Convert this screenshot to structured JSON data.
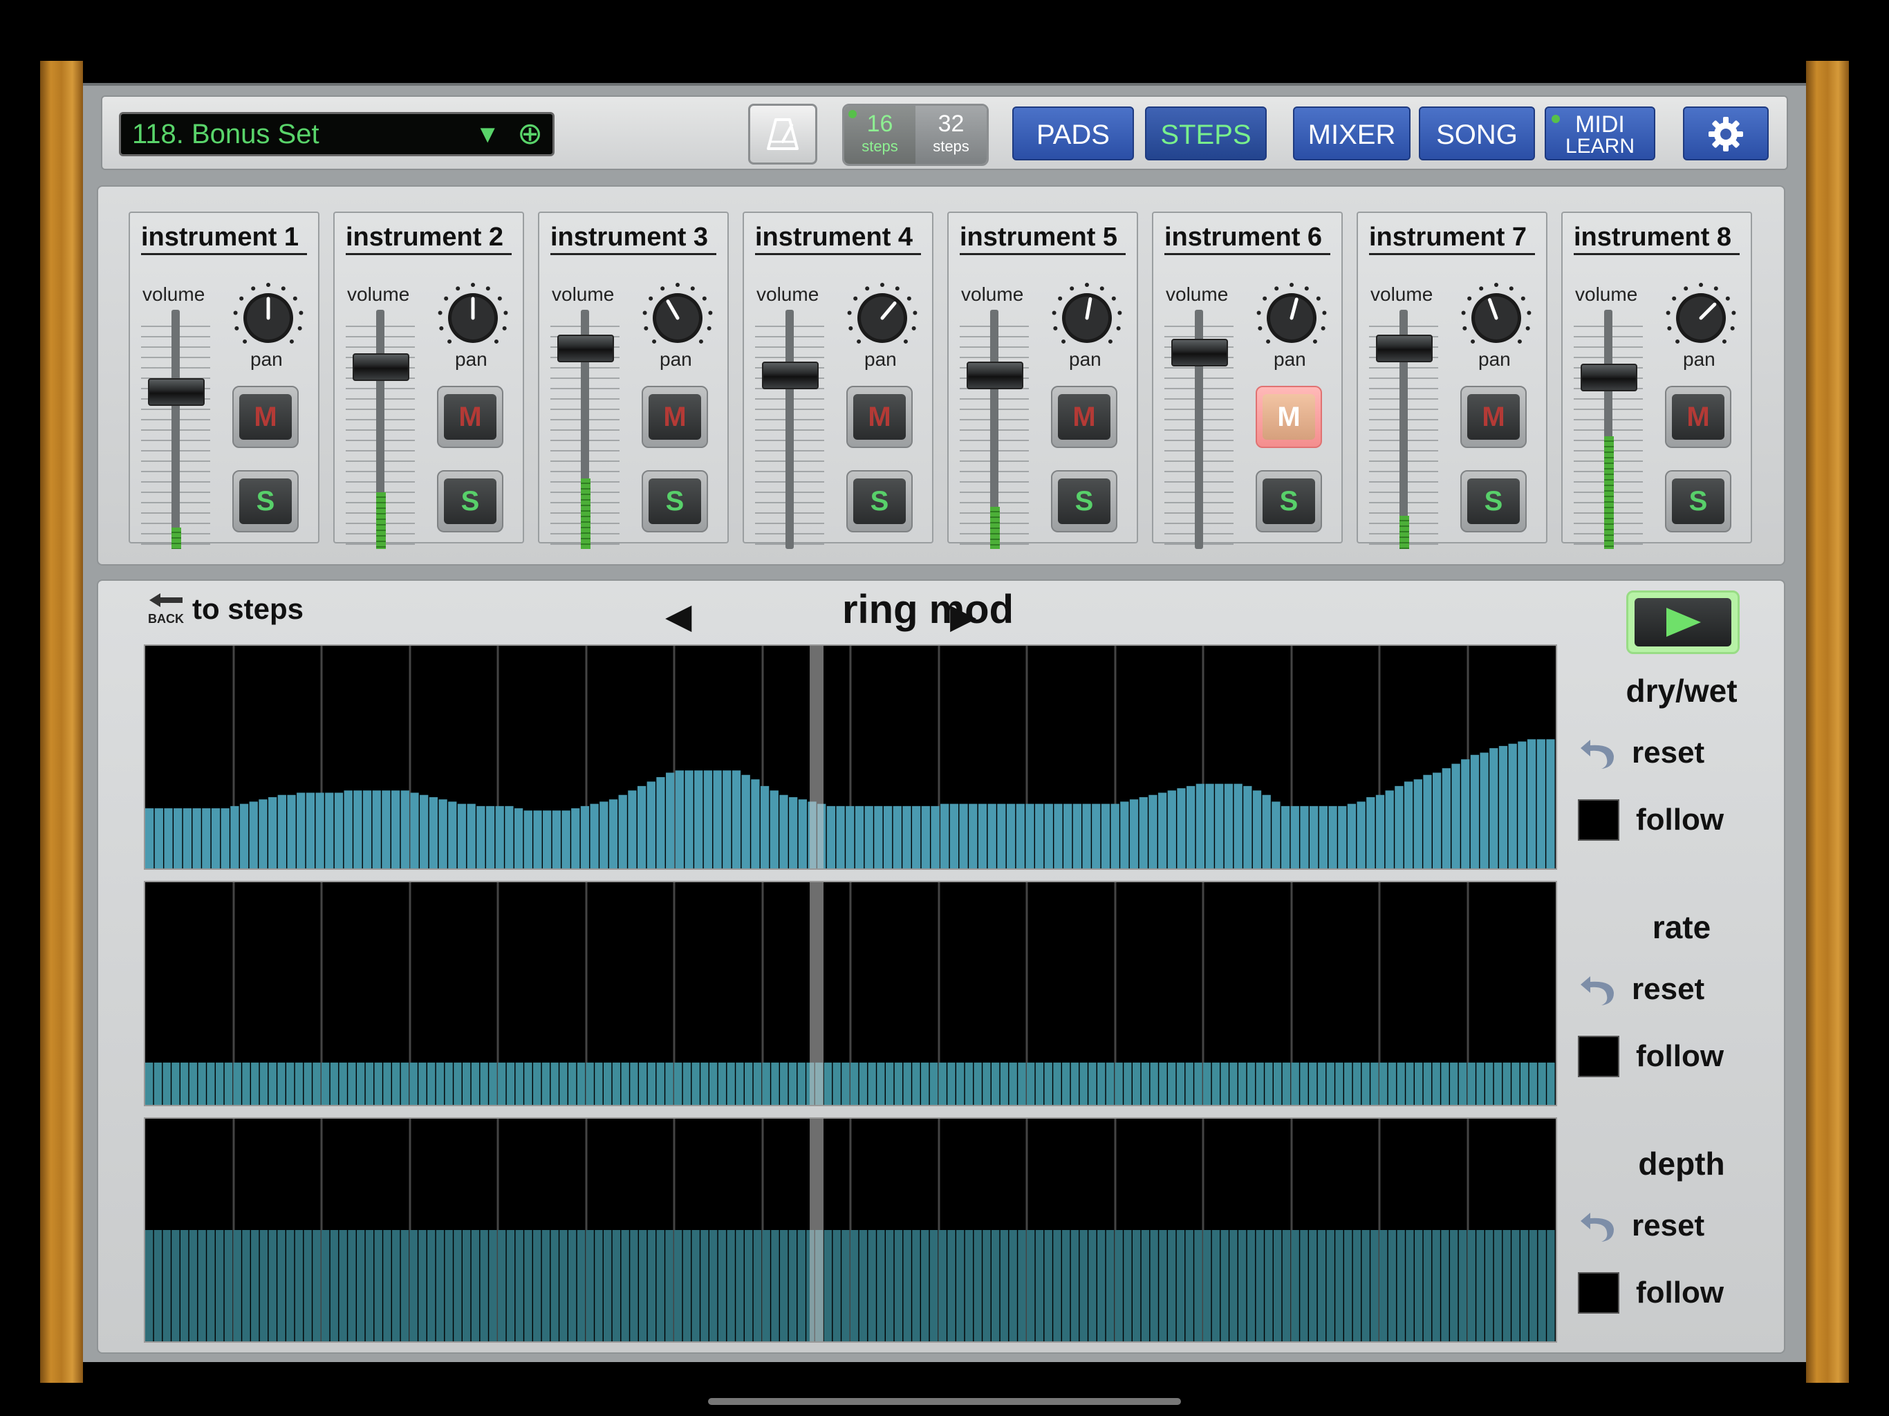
{
  "set": {
    "name": "118. Bonus Set",
    "dropdown_glyph": "▼",
    "add_glyph": "⊕"
  },
  "steps_toggle": [
    {
      "num": "16",
      "label": "steps",
      "active": true
    },
    {
      "num": "32",
      "label": "steps",
      "active": false
    }
  ],
  "nav": {
    "pads": "PADS",
    "steps": "STEPS",
    "mixer": "MIXER",
    "song": "SONG",
    "midi": "MIDI",
    "learn": "LEARN"
  },
  "labels": {
    "volume": "volume",
    "pan": "pan",
    "mute": "M",
    "solo": "S"
  },
  "instruments": [
    {
      "name": "instrument 1",
      "fader": 0.67,
      "meter": 0.09,
      "pan_deg": 0,
      "mute_on": false
    },
    {
      "name": "instrument 2",
      "fader": 0.79,
      "meter": 0.24,
      "pan_deg": 0,
      "mute_on": false
    },
    {
      "name": "instrument 3",
      "fader": 0.88,
      "meter": 0.3,
      "pan_deg": -30,
      "mute_on": false
    },
    {
      "name": "instrument 4",
      "fader": 0.75,
      "meter": 0.0,
      "pan_deg": 40,
      "mute_on": false
    },
    {
      "name": "instrument 5",
      "fader": 0.75,
      "meter": 0.18,
      "pan_deg": 10,
      "mute_on": false
    },
    {
      "name": "instrument 6",
      "fader": 0.86,
      "meter": 0.0,
      "pan_deg": 15,
      "mute_on": true
    },
    {
      "name": "instrument 7",
      "fader": 0.88,
      "meter": 0.14,
      "pan_deg": -20,
      "mute_on": false
    },
    {
      "name": "instrument 8",
      "fader": 0.74,
      "meter": 0.48,
      "pan_deg": 45,
      "mute_on": false
    }
  ],
  "fx": {
    "back_label": "to steps",
    "back_word": "BACK",
    "title": "ring mod",
    "prev": "◀",
    "next": "▶",
    "reset_label": "reset",
    "follow_label": "follow",
    "params": [
      {
        "name": "dry/wet",
        "color": "#4a9ab0",
        "values": [
          0.27,
          0.27,
          0.27,
          0.27,
          0.27,
          0.27,
          0.27,
          0.27,
          0.27,
          0.28,
          0.29,
          0.3,
          0.31,
          0.32,
          0.33,
          0.33,
          0.34,
          0.34,
          0.34,
          0.34,
          0.34,
          0.35,
          0.35,
          0.35,
          0.35,
          0.35,
          0.35,
          0.35,
          0.34,
          0.33,
          0.32,
          0.31,
          0.3,
          0.29,
          0.29,
          0.28,
          0.28,
          0.28,
          0.28,
          0.27,
          0.26,
          0.26,
          0.26,
          0.26,
          0.26,
          0.27,
          0.28,
          0.29,
          0.3,
          0.31,
          0.33,
          0.35,
          0.37,
          0.39,
          0.41,
          0.43,
          0.44,
          0.44,
          0.44,
          0.44,
          0.44,
          0.44,
          0.44,
          0.42,
          0.4,
          0.37,
          0.35,
          0.33,
          0.32,
          0.31,
          0.3,
          0.29,
          0.28,
          0.28,
          0.28,
          0.28,
          0.28,
          0.28,
          0.28,
          0.28,
          0.28,
          0.28,
          0.28,
          0.28,
          0.29,
          0.29,
          0.29,
          0.29,
          0.29,
          0.29,
          0.29,
          0.29,
          0.29,
          0.29,
          0.29,
          0.29,
          0.29,
          0.29,
          0.29,
          0.29,
          0.29,
          0.29,
          0.29,
          0.3,
          0.31,
          0.32,
          0.33,
          0.34,
          0.35,
          0.36,
          0.37,
          0.38,
          0.38,
          0.38,
          0.38,
          0.38,
          0.37,
          0.35,
          0.33,
          0.3,
          0.28,
          0.28,
          0.28,
          0.28,
          0.28,
          0.28,
          0.28,
          0.29,
          0.3,
          0.32,
          0.33,
          0.35,
          0.37,
          0.39,
          0.4,
          0.42,
          0.43,
          0.45,
          0.47,
          0.49,
          0.51,
          0.52,
          0.54,
          0.55,
          0.56,
          0.57,
          0.58,
          0.58,
          0.58
        ]
      },
      {
        "name": "rate",
        "color": "#3f8c9a",
        "constant": 0.19
      },
      {
        "name": "depth",
        "color": "#2f6d78",
        "constant": 0.5
      }
    ],
    "playhead_fraction": 0.476
  }
}
